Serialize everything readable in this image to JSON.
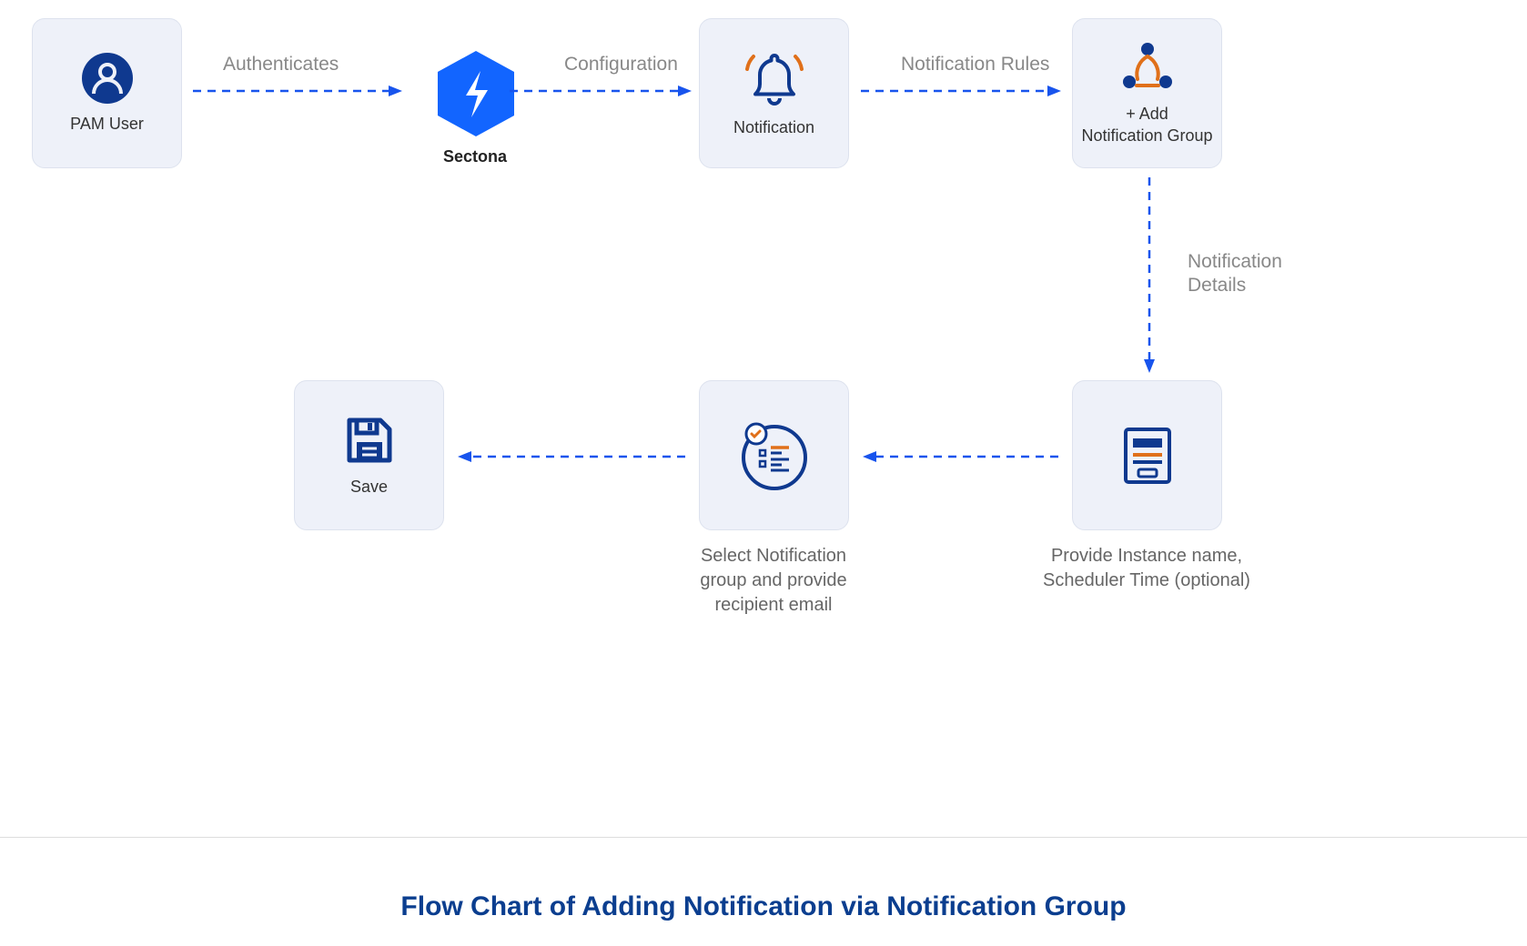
{
  "nodes": {
    "pam_user": {
      "label": "PAM User"
    },
    "sectona": {
      "label": "Sectona"
    },
    "notification": {
      "label": "Notification"
    },
    "add_group": {
      "label": "+ Add\nNotification Group"
    },
    "provide_instance": {
      "label_outside": "Provide Instance name,\nScheduler Time (optional)"
    },
    "select_group": {
      "label_outside": "Select Notification\ngroup and provide\nrecipient email"
    },
    "save": {
      "label": "Save"
    }
  },
  "edges": {
    "authenticates": "Authenticates",
    "configuration": "Configuration",
    "notification_rules": "Notification Rules",
    "notification_details": "Notification\nDetails"
  },
  "footer_title": "Flow Chart of Adding Notification via Notification Group",
  "colors": {
    "blue": "#1854ED",
    "dark_blue": "#0F398F",
    "orange": "#E0701A"
  }
}
